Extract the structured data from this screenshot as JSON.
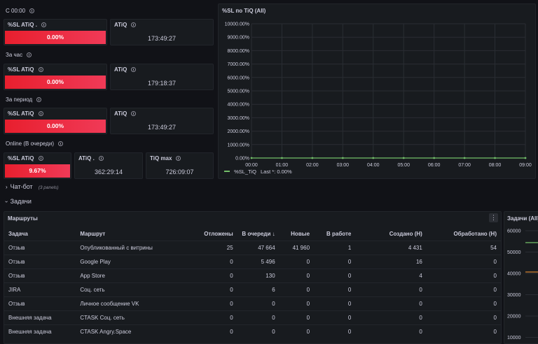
{
  "sections": {
    "since_midnight": "С 00:00",
    "per_hour": "За час",
    "per_period": "За период",
    "online": "Online (В очереди)"
  },
  "stats": {
    "row1": {
      "sl_title": "%SL ATiQ .",
      "sl_value": "0.00%",
      "atiq_title": "ATiQ",
      "atiq_value": "173:49:27"
    },
    "row2": {
      "sl_title": "%SL ATiQ",
      "sl_value": "0.00%",
      "atiq_title": "ATiQ",
      "atiq_value": "179:18:37"
    },
    "row3": {
      "sl_title": "%SL ATiQ",
      "sl_value": "0.00%",
      "atiq_title": "ATiQ",
      "atiq_value": "173:49:27"
    },
    "row4": {
      "sl_title": "%SL ATiQ",
      "sl_value": "9.67%",
      "atiq_title": "ATiQ .",
      "atiq_value": "362:29:14",
      "tiqmax_title": "TiQ max",
      "tiqmax_value": "726:09:07"
    }
  },
  "chart_panel": {
    "title": "%SL по TiQ (All)",
    "legend_label": "%SL_TiQ",
    "legend_last": "Last *: 0.00%"
  },
  "chart_data": {
    "type": "line",
    "x": [
      "00:00",
      "01:00",
      "02:00",
      "03:00",
      "04:00",
      "05:00",
      "06:00",
      "07:00",
      "08:00",
      "09:00"
    ],
    "yticks": [
      "10000.00%",
      "9000.00%",
      "8000.00%",
      "7000.00%",
      "6000.00%",
      "5000.00%",
      "4000.00%",
      "3000.00%",
      "2000.00%",
      "1000.00%",
      "0.00%"
    ],
    "ylim": [
      0,
      10000
    ],
    "series": [
      {
        "name": "%SL_TiQ",
        "values": [
          0,
          0,
          0,
          0,
          0,
          0,
          0,
          0,
          0,
          0
        ],
        "color": "#73bf69"
      }
    ]
  },
  "rows": {
    "chatbot": "Чат-бот",
    "chatbot_hint": "(3 panels)",
    "tasks": "Задачи"
  },
  "routes_table": {
    "title": "Маршруты",
    "columns": [
      "Задача",
      "Маршрут",
      "Отложены",
      "В очереди ↓",
      "Новые",
      "В работе",
      "Создано (Н)",
      "Обработано (Н)"
    ],
    "rows": [
      [
        "Отзыв",
        "Опубликованный с витрины",
        "25",
        "47 664",
        "41 960",
        "1",
        "4 431",
        "54"
      ],
      [
        "Отзыв",
        "Google Play",
        "0",
        "5 496",
        "0",
        "0",
        "16",
        "0"
      ],
      [
        "Отзыв",
        "App Store",
        "0",
        "130",
        "0",
        "0",
        "4",
        "0"
      ],
      [
        "JIRA",
        "Соц. сеть",
        "0",
        "6",
        "0",
        "0",
        "0",
        "0"
      ],
      [
        "Отзыв",
        "Личное сообщение VK",
        "0",
        "0",
        "0",
        "0",
        "0",
        "0"
      ],
      [
        "Внешняя задача",
        "CTASK Соц. сеть",
        "0",
        "0",
        "0",
        "0",
        "0",
        "0"
      ],
      [
        "Внешняя задача",
        "CTASK Angry.Space",
        "0",
        "0",
        "0",
        "0",
        "0",
        "0"
      ]
    ]
  },
  "tasks_panel": {
    "title": "Задачи (All)",
    "yticks": [
      "60000",
      "50000",
      "40000",
      "30000",
      "20000",
      "10000"
    ]
  },
  "colors": {
    "background": "#111217",
    "panel": "#181b1f",
    "red": "#e02f44",
    "green": "#73bf69"
  }
}
